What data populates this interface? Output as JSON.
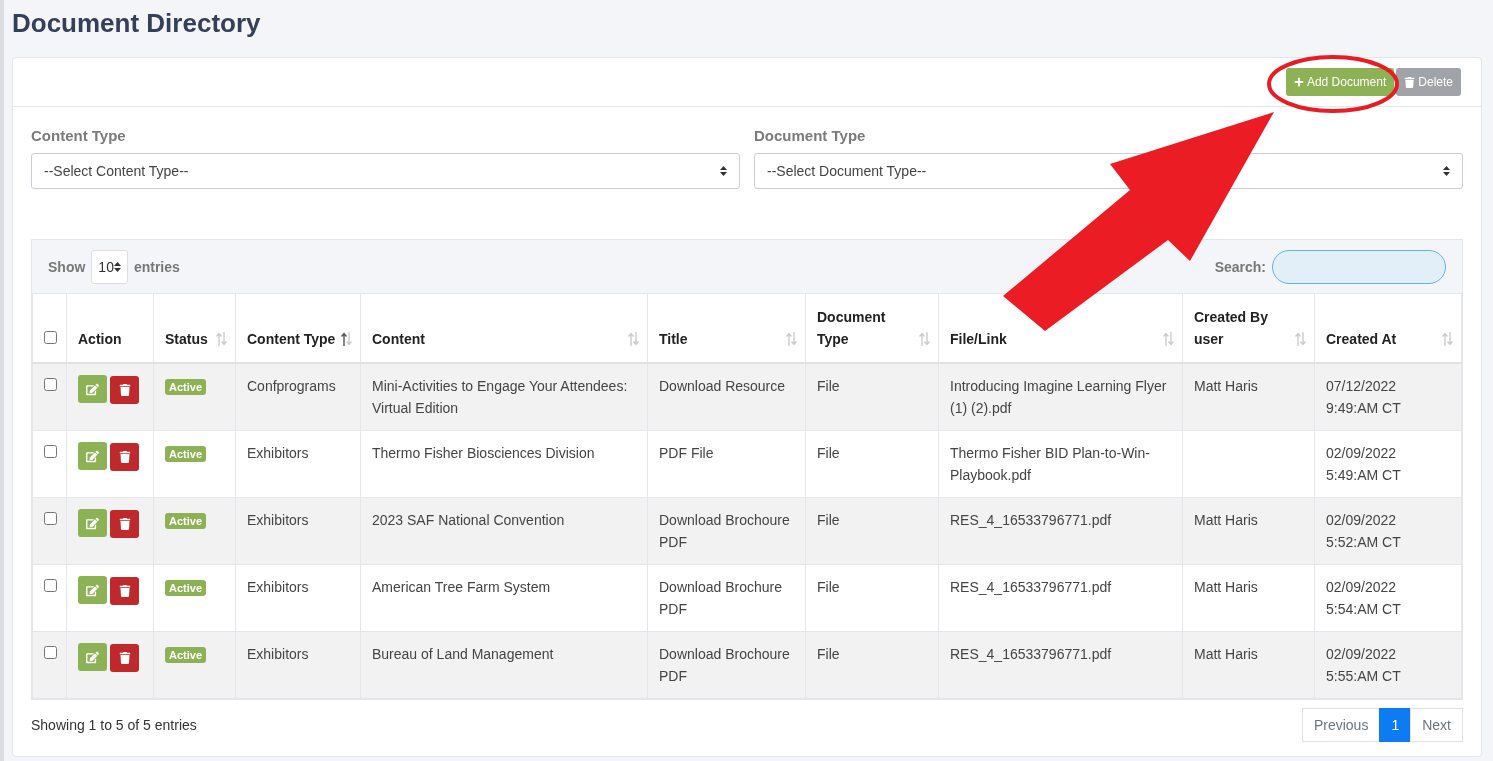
{
  "page_title": "Document Directory",
  "toolbar": {
    "buttons": [
      {
        "kind": "add",
        "label": "Add Document"
      },
      {
        "kind": "delete",
        "label": "Delete"
      }
    ]
  },
  "filters": [
    {
      "label": "Content Type",
      "value": "--Select Content Type--"
    },
    {
      "label": "Document Type",
      "value": "--Select Document Type--"
    }
  ],
  "table_controls": {
    "show_label": "Show",
    "page_size": "10",
    "entries_label": "entries",
    "search_label": "Search:"
  },
  "table": {
    "select_all_checked": false,
    "columns": [
      {
        "label": "Action",
        "sortable": false
      },
      {
        "label": "Status",
        "sortable": true,
        "sorted_ascending": false
      },
      {
        "label": "Content Type",
        "sortable": true,
        "sorted_ascending": true
      },
      {
        "label": "Content",
        "sortable": true,
        "sorted_ascending": false
      },
      {
        "label": "Title",
        "sortable": true,
        "sorted_ascending": false
      },
      {
        "label": "Document Type",
        "sortable": true,
        "sorted_ascending": false
      },
      {
        "label": "File/Link",
        "sortable": true,
        "sorted_ascending": false
      },
      {
        "label": "Created By user",
        "sortable": true,
        "sorted_ascending": false
      },
      {
        "label": "Created At",
        "sortable": true,
        "sorted_ascending": false
      }
    ],
    "rows": [
      {
        "checked": false,
        "cells": [
          {
            "kind": "actions"
          },
          {
            "kind": "status",
            "text": "Active"
          },
          {
            "kind": "text",
            "text": "Confprograms"
          },
          {
            "kind": "text",
            "text": "Mini-Activities to Engage Your Attendees: Virtual Edition"
          },
          {
            "kind": "text",
            "text": "Download Resource"
          },
          {
            "kind": "text",
            "text": "File"
          },
          {
            "kind": "text",
            "text": "Introducing Imagine Learning Flyer (1) (2).pdf"
          },
          {
            "kind": "text",
            "text": "Matt Haris"
          },
          {
            "kind": "text",
            "text": "07/12/2022 9:49:AM CT"
          }
        ]
      },
      {
        "checked": false,
        "cells": [
          {
            "kind": "actions"
          },
          {
            "kind": "status",
            "text": "Active"
          },
          {
            "kind": "text",
            "text": "Exhibitors"
          },
          {
            "kind": "text",
            "text": "Thermo Fisher Biosciences Division"
          },
          {
            "kind": "text",
            "text": "PDF File"
          },
          {
            "kind": "text",
            "text": "File"
          },
          {
            "kind": "text",
            "text": "Thermo Fisher BID Plan-to-Win-Playbook.pdf"
          },
          {
            "kind": "text",
            "text": ""
          },
          {
            "kind": "text",
            "text": "02/09/2022 5:49:AM CT"
          }
        ]
      },
      {
        "checked": false,
        "cells": [
          {
            "kind": "actions"
          },
          {
            "kind": "status",
            "text": "Active"
          },
          {
            "kind": "text",
            "text": "Exhibitors"
          },
          {
            "kind": "text",
            "text": "2023 SAF National Convention"
          },
          {
            "kind": "text",
            "text": "Download Brochoure PDF"
          },
          {
            "kind": "text",
            "text": "File"
          },
          {
            "kind": "text",
            "text": "RES_4_16533796771.pdf"
          },
          {
            "kind": "text",
            "text": "Matt Haris"
          },
          {
            "kind": "text",
            "text": "02/09/2022 5:52:AM CT"
          }
        ]
      },
      {
        "checked": false,
        "cells": [
          {
            "kind": "actions"
          },
          {
            "kind": "status",
            "text": "Active"
          },
          {
            "kind": "text",
            "text": "Exhibitors"
          },
          {
            "kind": "text",
            "text": "American Tree Farm System"
          },
          {
            "kind": "text",
            "text": "Download Brochure PDF"
          },
          {
            "kind": "text",
            "text": "File"
          },
          {
            "kind": "text",
            "text": "RES_4_16533796771.pdf"
          },
          {
            "kind": "text",
            "text": "Matt Haris"
          },
          {
            "kind": "text",
            "text": "02/09/2022 5:54:AM CT"
          }
        ]
      },
      {
        "checked": false,
        "cells": [
          {
            "kind": "actions"
          },
          {
            "kind": "status",
            "text": "Active"
          },
          {
            "kind": "text",
            "text": "Exhibitors"
          },
          {
            "kind": "text",
            "text": "Bureau of Land Management"
          },
          {
            "kind": "text",
            "text": "Download Brochoure PDF"
          },
          {
            "kind": "text",
            "text": "File"
          },
          {
            "kind": "text",
            "text": "RES_4_16533796771.pdf"
          },
          {
            "kind": "text",
            "text": "Matt Haris"
          },
          {
            "kind": "text",
            "text": "02/09/2022 5:55:AM CT"
          }
        ]
      }
    ]
  },
  "footer": {
    "info": "Showing 1 to 5 of 5 entries",
    "pagination": [
      {
        "label": "Previous",
        "selected": false,
        "disabled": true
      },
      {
        "label": "1",
        "selected": true,
        "disabled": false
      },
      {
        "label": "Next",
        "selected": false,
        "disabled": true
      }
    ]
  }
}
